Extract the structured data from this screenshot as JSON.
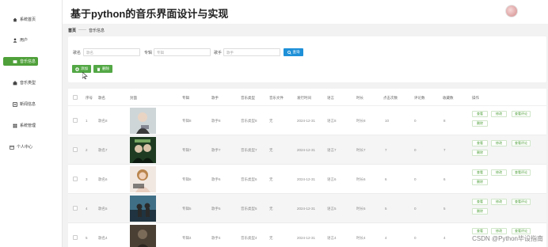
{
  "app": {
    "title": "基于python的音乐界面设计与实现"
  },
  "sidebar": {
    "items": [
      {
        "label": "系统首页",
        "icon": "home-icon",
        "active": false
      },
      {
        "label": "用户",
        "icon": "user-icon",
        "active": false
      },
      {
        "label": "音乐信息",
        "icon": "music-icon",
        "active": true
      },
      {
        "label": "音乐类型",
        "icon": "category-icon",
        "active": false
      },
      {
        "label": "新闻信息",
        "icon": "news-icon",
        "active": false
      },
      {
        "label": "系统管理",
        "icon": "grid-icon",
        "active": false
      },
      {
        "label": "个人中心",
        "icon": "calendar-icon",
        "active": false
      }
    ]
  },
  "breadcrumb": {
    "home": "首页",
    "sep": "——",
    "current": "音乐信息"
  },
  "search": {
    "name_label": "歌名",
    "name_placeholder": "歌名",
    "singer_label": "专辑",
    "singer_placeholder": "专辑",
    "type_label": "歌手",
    "type_placeholder": "歌手",
    "search_button": "查询"
  },
  "actions": {
    "add": "添加",
    "delete": "删除"
  },
  "table": {
    "headers": [
      "序号",
      "歌名",
      "封面",
      "专辑",
      "歌手",
      "音乐类型",
      "音乐文件",
      "发行时间",
      "语言",
      "时长",
      "点击次数",
      "评论数",
      "收藏数",
      "操作"
    ],
    "rows": [
      {
        "no": "1",
        "name": "歌名8",
        "album": "专辑8",
        "singer": "歌手8",
        "type": "音乐类型8",
        "file": "无",
        "date": "2024-12-31",
        "lang": "语言8",
        "dur": "时长8",
        "clicks": "10",
        "comments": "0",
        "favs": "8"
      },
      {
        "no": "2",
        "name": "歌名7",
        "album": "专辑7",
        "singer": "歌手7",
        "type": "音乐类型7",
        "file": "无",
        "date": "2024-12-31",
        "lang": "语言7",
        "dur": "时长7",
        "clicks": "7",
        "comments": "0",
        "favs": "7"
      },
      {
        "no": "3",
        "name": "歌名6",
        "album": "专辑6",
        "singer": "歌手6",
        "type": "音乐类型6",
        "file": "无",
        "date": "2024-12-31",
        "lang": "语言6",
        "dur": "时长6",
        "clicks": "6",
        "comments": "0",
        "favs": "6"
      },
      {
        "no": "4",
        "name": "歌名5",
        "album": "专辑5",
        "singer": "歌手5",
        "type": "音乐类型5",
        "file": "无",
        "date": "2024-12-31",
        "lang": "语言5",
        "dur": "时长5",
        "clicks": "5",
        "comments": "0",
        "favs": "5"
      },
      {
        "no": "5",
        "name": "歌名4",
        "album": "专辑4",
        "singer": "歌手4",
        "type": "音乐类型4",
        "file": "无",
        "date": "2024-12-31",
        "lang": "语言4",
        "dur": "时长4",
        "clicks": "4",
        "comments": "0",
        "favs": "4"
      }
    ],
    "row_actions": {
      "view": "查看",
      "edit": "修改",
      "view_comments": "查看评论",
      "delete": "删除"
    }
  },
  "watermark": "CSDN @Python毕设指南",
  "colors": {
    "accent": "#4fa03a",
    "search": "#1e90d8"
  }
}
